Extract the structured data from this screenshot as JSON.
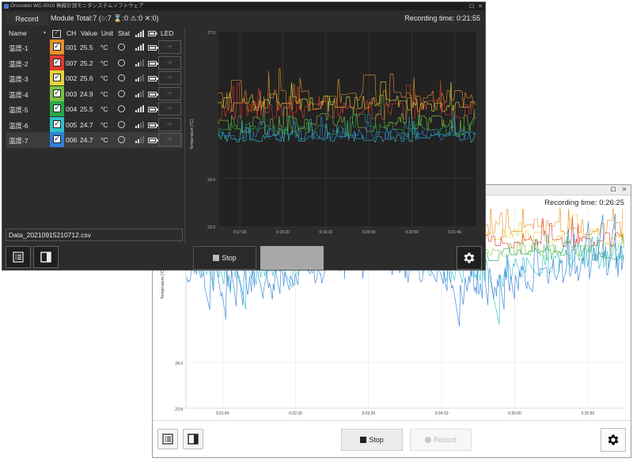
{
  "back_window": {
    "title_buttons": [
      "ロ",
      "✕"
    ],
    "recording_time_label": "Recording time:",
    "recording_time": "0:26:25",
    "chart": {
      "y_label": "Temperature [°C]",
      "y_ticks": [
        "24.0",
        "23.8"
      ],
      "x_ticks": [
        "0:21:40",
        "0:22:30",
        "0:23:20",
        "0:24:10",
        "0:25:00",
        "0:25:50"
      ]
    },
    "stop_label": "Stop",
    "record_label": "Record",
    "icons": [
      "list-view-icon",
      "panel-toggle-icon",
      "gear-icon"
    ]
  },
  "front_window": {
    "title": "Onosokki WC-0010 無線計測モニタシステムソフトウェア",
    "title_buttons": [
      "ロ",
      "✕"
    ],
    "record_button": "Record",
    "module_total": "Module Total:7 (○:7 ⌛:0 ⚠:0 ✕:0)",
    "recording_time_label": "Recording time:",
    "recording_time": "0:21:55",
    "columns": [
      "Name",
      "CH",
      "Value",
      "Unit",
      "Stat",
      "LED"
    ],
    "channels": [
      {
        "name": "温度-1",
        "color": "#e8902a",
        "ch": "001",
        "value": "25.5",
        "unit": "°C",
        "signal": "full"
      },
      {
        "name": "温度-2",
        "color": "#e03a2e",
        "ch": "007",
        "value": "25.2",
        "unit": "°C",
        "signal": "weak"
      },
      {
        "name": "温度-3",
        "color": "#e4d43a",
        "ch": "002",
        "value": "25.6",
        "unit": "°C",
        "signal": "weak"
      },
      {
        "name": "温度-4",
        "color": "#7ac143",
        "ch": "003",
        "value": "24.9",
        "unit": "°C",
        "signal": "weak"
      },
      {
        "name": "温度-5",
        "color": "#2aa84a",
        "ch": "004",
        "value": "25.5",
        "unit": "°C",
        "signal": "full"
      },
      {
        "name": "温度-6",
        "color": "#2fc0c8",
        "ch": "005",
        "value": "24.7",
        "unit": "°C",
        "signal": "weak"
      },
      {
        "name": "温度-7",
        "color": "#2f80d8",
        "ch": "006",
        "value": "24.7",
        "unit": "°C",
        "signal": "weak"
      }
    ],
    "file_name": "Data_20210915210712.csv",
    "chart": {
      "y_label": "Temperature [°C]",
      "y_ticks": [
        "27.0",
        "24.0",
        "23.0"
      ],
      "x_ticks": [
        "0:17:30",
        "0:18:20",
        "0:19:10",
        "0:20:00",
        "0:20:50",
        "0:21:40"
      ]
    },
    "stop_label": "Stop",
    "icons": [
      "list-view-icon",
      "panel-toggle-icon",
      "gear-icon"
    ]
  }
}
